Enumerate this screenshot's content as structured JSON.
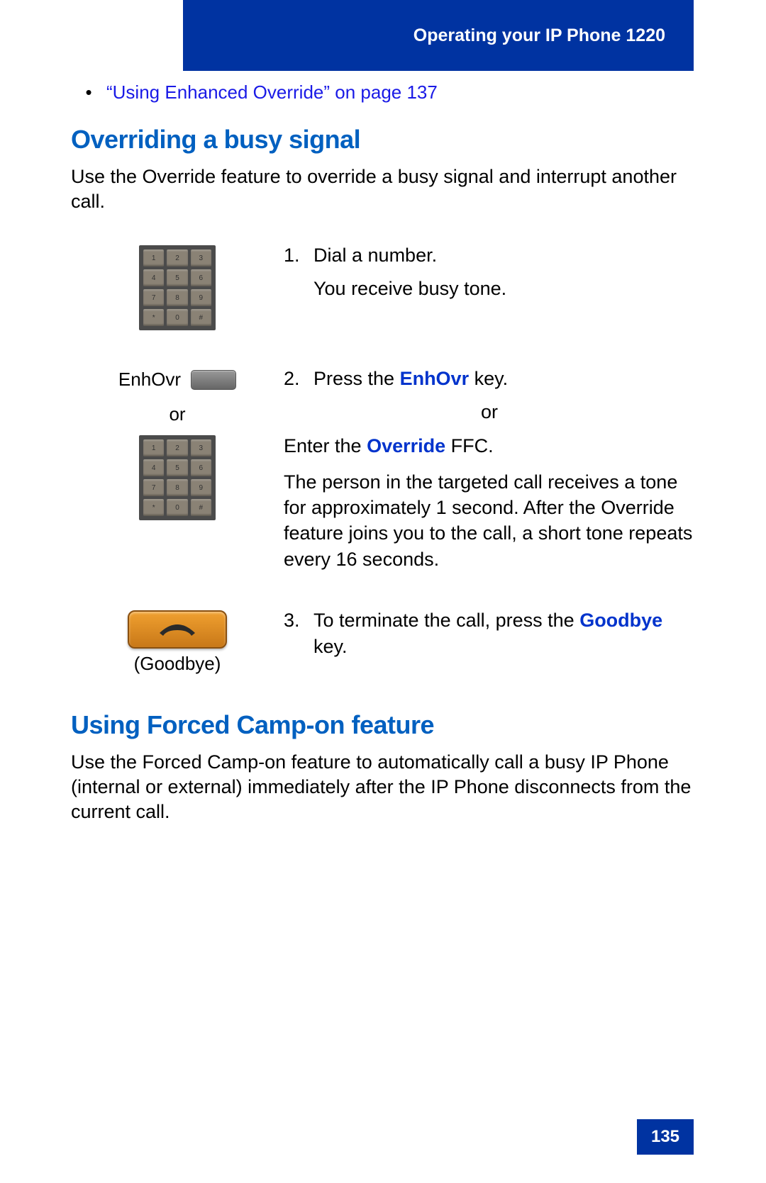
{
  "header": {
    "title": "Operating your IP Phone 1220"
  },
  "bullet": {
    "text": "“Using Enhanced Override” on page 137"
  },
  "section1": {
    "heading": "Overriding a busy signal",
    "intro": "Use the Override feature to override a busy signal and interrupt another call."
  },
  "steps": {
    "s1": {
      "num": "1.",
      "line1": "Dial a number.",
      "line2": "You receive busy tone."
    },
    "s2": {
      "softkeyLabel": "EnhOvr",
      "orLabel": "or",
      "num": "2.",
      "pressPrefix": "Press the ",
      "pressKey": "EnhOvr",
      "pressSuffix": " key.",
      "or": "or",
      "enterPrefix": "Enter the ",
      "enterKey": "Override",
      "enterSuffix": " FFC.",
      "desc": "The person in the targeted call receives a tone for approximately 1 second. After the Override feature joins you to the call, a short tone repeats every 16 seconds."
    },
    "s3": {
      "btnLabel": "(Goodbye)",
      "num": "3.",
      "textPrefix": "To terminate the call, press the ",
      "key": "Goodbye",
      "textSuffix": " key."
    }
  },
  "section2": {
    "heading": "Using Forced Camp-on feature",
    "intro": "Use the Forced Camp-on feature to automatically call a busy IP Phone (internal or external) immediately after the IP Phone disconnects from the current call."
  },
  "pageNumber": "135",
  "keypad": [
    "1",
    "2",
    "3",
    "4",
    "5",
    "6",
    "7",
    "8",
    "9",
    "*",
    "0",
    "#"
  ]
}
